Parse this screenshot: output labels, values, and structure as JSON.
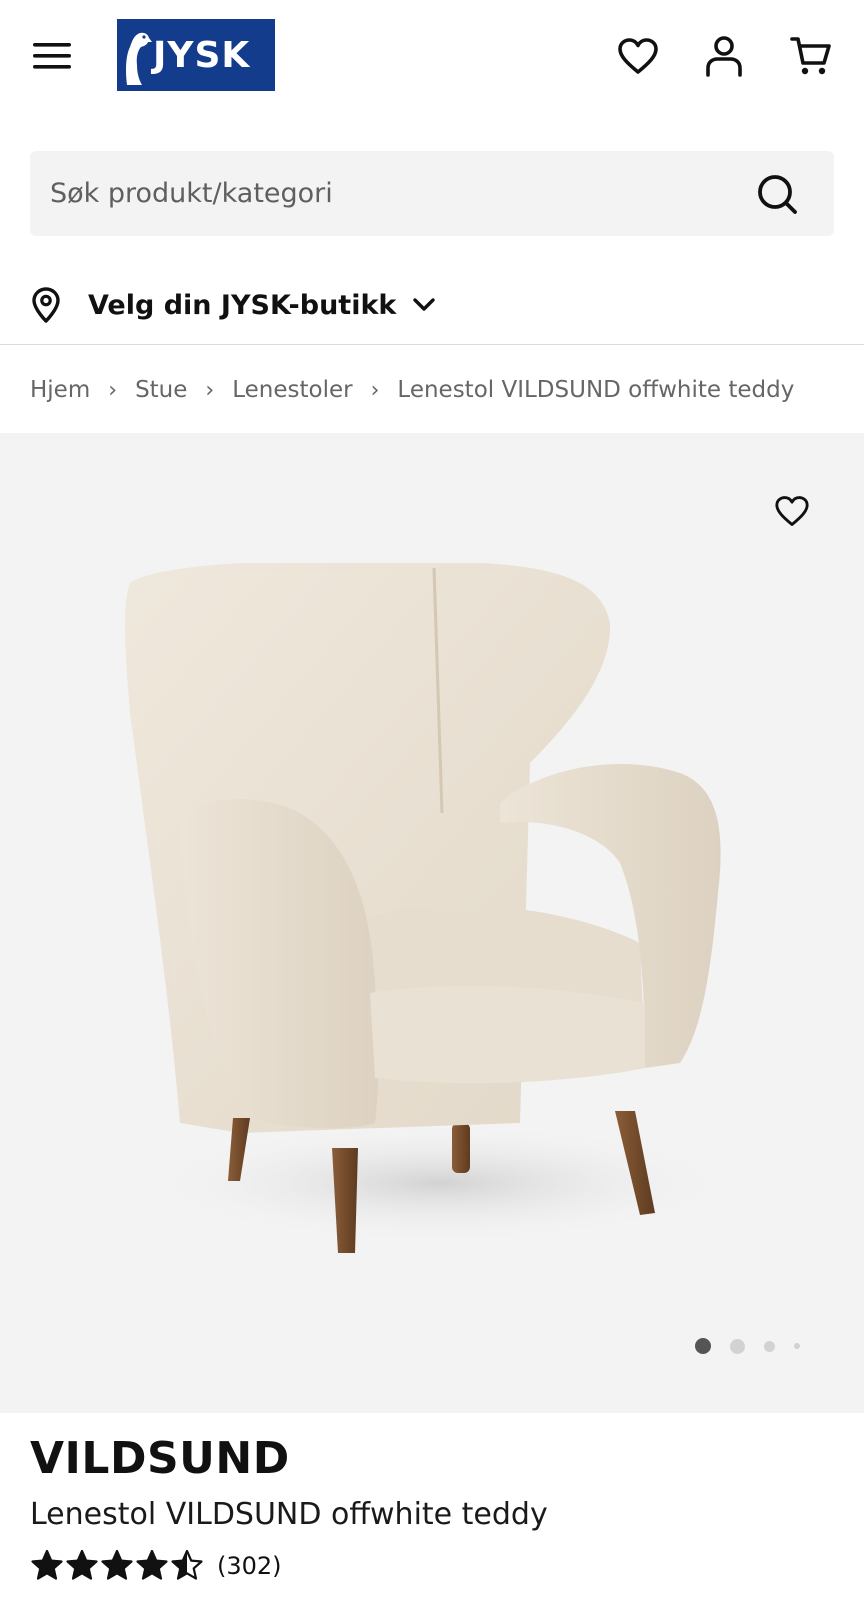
{
  "header": {
    "logo_text": "JYSK",
    "icons": [
      "menu-icon",
      "heart-icon",
      "user-icon",
      "cart-icon"
    ]
  },
  "search": {
    "placeholder": "Søk produkt/kategori"
  },
  "store": {
    "label": "Velg din JYSK-butikk"
  },
  "breadcrumb": {
    "items": [
      "Hjem",
      "Stue",
      "Lenestoler",
      "Lenestol VILDSUND offwhite teddy"
    ]
  },
  "gallery": {
    "image_count": 4,
    "active_index": 0
  },
  "product": {
    "brand": "VILDSUND",
    "title": "Lenestol VILDSUND offwhite teddy",
    "rating": 4.5,
    "review_count": "(302)"
  },
  "colors": {
    "brand_blue": "#143c8c",
    "gallery_bg": "#f3f3f4",
    "search_bg": "#f3f3f3"
  }
}
